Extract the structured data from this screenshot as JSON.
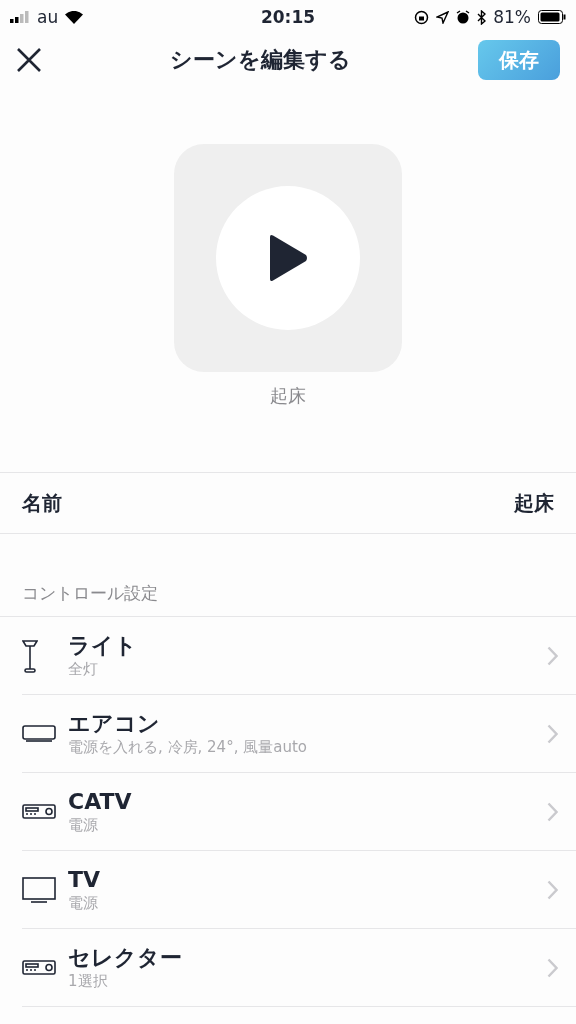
{
  "status_bar": {
    "carrier": "au",
    "time": "20:15",
    "battery": "81%"
  },
  "nav": {
    "title": "シーンを編集する",
    "save": "保存"
  },
  "scene": {
    "caption": "起床"
  },
  "name_row": {
    "label": "名前",
    "value": "起床"
  },
  "section": {
    "title": "コントロール設定"
  },
  "devices": [
    {
      "kind": "light",
      "name": "ライト",
      "detail": "全灯"
    },
    {
      "kind": "aircon",
      "name": "エアコン",
      "detail": "電源を入れる, 冷房, 24°, 風量auto"
    },
    {
      "kind": "receiver",
      "name": "CATV",
      "detail": "電源"
    },
    {
      "kind": "tv",
      "name": "TV",
      "detail": "電源"
    },
    {
      "kind": "receiver",
      "name": "セレクター",
      "detail": "1選択"
    }
  ]
}
